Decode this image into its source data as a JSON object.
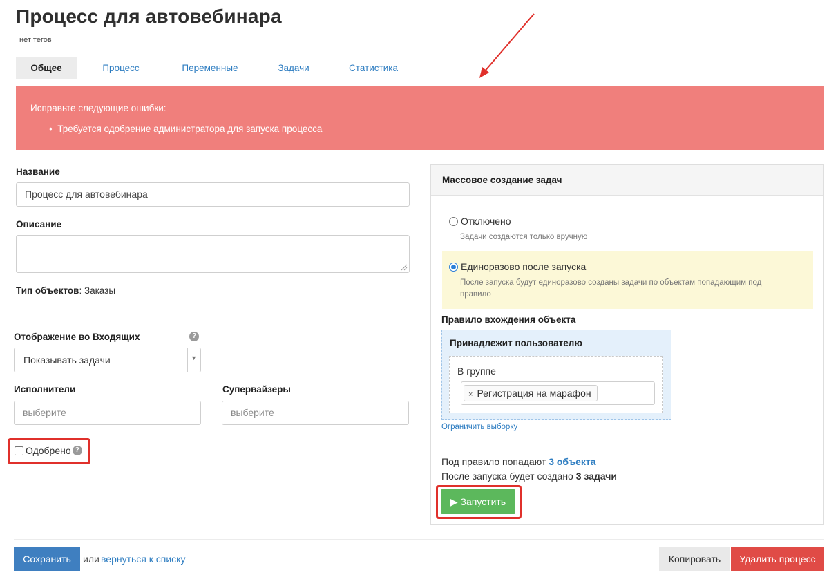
{
  "header": {
    "title": "Процесс для автовебинара",
    "tags": "нет тегов"
  },
  "tabs": [
    {
      "label": "Общее",
      "active": true
    },
    {
      "label": "Процесс",
      "active": false
    },
    {
      "label": "Переменные",
      "active": false
    },
    {
      "label": "Задачи",
      "active": false
    },
    {
      "label": "Статистика",
      "active": false
    }
  ],
  "alert": {
    "title": "Исправьте следующие ошибки:",
    "items": [
      "Требуется одобрение администратора для запуска процесса"
    ],
    "color": "#f07f7c"
  },
  "form": {
    "name_label": "Название",
    "name_value": "Процесс для автовебинара",
    "description_label": "Описание",
    "description_value": "",
    "object_type_label": "Тип объектов",
    "object_type_value": ": Заказы",
    "inbox_label": "Отображение во Входящих",
    "inbox_value": "Показывать задачи",
    "executors_label": "Исполнители",
    "executors_placeholder": "выберите",
    "supervisors_label": "Супервайзеры",
    "supervisors_placeholder": "выберите",
    "approved_label": "Одобрено",
    "approved_checked": false,
    "help_glyph": "?"
  },
  "mass_tasks": {
    "header": "Массовое создание задач",
    "options": [
      {
        "label": "Отключено",
        "hint": "Задачи создаются только вручную",
        "selected": false
      },
      {
        "label": "Единоразово после запуска",
        "hint_line1": "После запуска будут единоразово созданы задачи по объектам попадающим под",
        "hint_line2": "правило",
        "selected": true
      }
    ],
    "rule_label": "Правило вхождения объекта",
    "rule_box_title": "Принадлежит пользователю",
    "in_group_label": "В группе",
    "group_tag": "Регистрация на марафон",
    "tag_remove_glyph": "×",
    "limit_link": "Ограничить выборку",
    "match_text": "Под правило попадают ",
    "match_count": "3 объекта",
    "created_text": "После запуска будет создано ",
    "created_count": "3 задачи",
    "run_button": "▶ Запустить"
  },
  "footer": {
    "save_button": "Сохранить",
    "or_text": "или",
    "back_link": "вернуться к списку",
    "copy_button": "Копировать",
    "delete_button": "Удалить процесс"
  },
  "colors": {
    "accent_blue": "#2e7dc1",
    "save_blue": "#3f7fc0",
    "run_green": "#5cb85c",
    "delete_red": "#e04b46",
    "highlight_red": "#e0302b"
  }
}
